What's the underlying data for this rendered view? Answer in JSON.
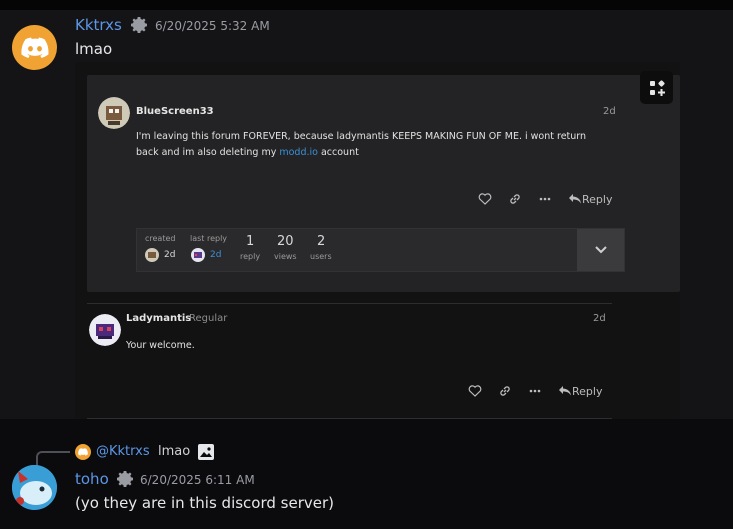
{
  "message1": {
    "username": "Kktrxs",
    "timestamp": "6/20/2025 5:32 AM",
    "text": "lmao"
  },
  "embed": {
    "post": {
      "author": "BlueScreen33",
      "date": "2d",
      "body_line1": "I'm leaving this forum FOREVER, because ladymantis KEEPS MAKING FUN OF ME. i wont return",
      "body_line2_before": "back and im also deleting my ",
      "body_link": "modd.io",
      "body_line2_after": " account",
      "reply_label": "Reply",
      "stats": {
        "created_label": "created",
        "created_value": "2d",
        "last_reply_label": "last reply",
        "last_reply_value": "2d",
        "replies_value": "1",
        "replies_label": "reply",
        "views_value": "20",
        "views_label": "views",
        "users_value": "2",
        "users_label": "users"
      }
    },
    "reply_post": {
      "author": "Ladymantis",
      "role": "Regular",
      "date": "2d",
      "body": "Your welcome.",
      "reply_label": "Reply"
    }
  },
  "message2": {
    "reply_ref_user": "@Kktrxs",
    "reply_ref_text": "lmao",
    "username": "toho",
    "timestamp": "6/20/2025 6:11 AM",
    "text": "(yo they are in this discord server)"
  },
  "colors": {
    "username_blue": "#5c96e6",
    "link_blue": "#3a90d8",
    "discord_avatar_bg": "#f0a232"
  }
}
